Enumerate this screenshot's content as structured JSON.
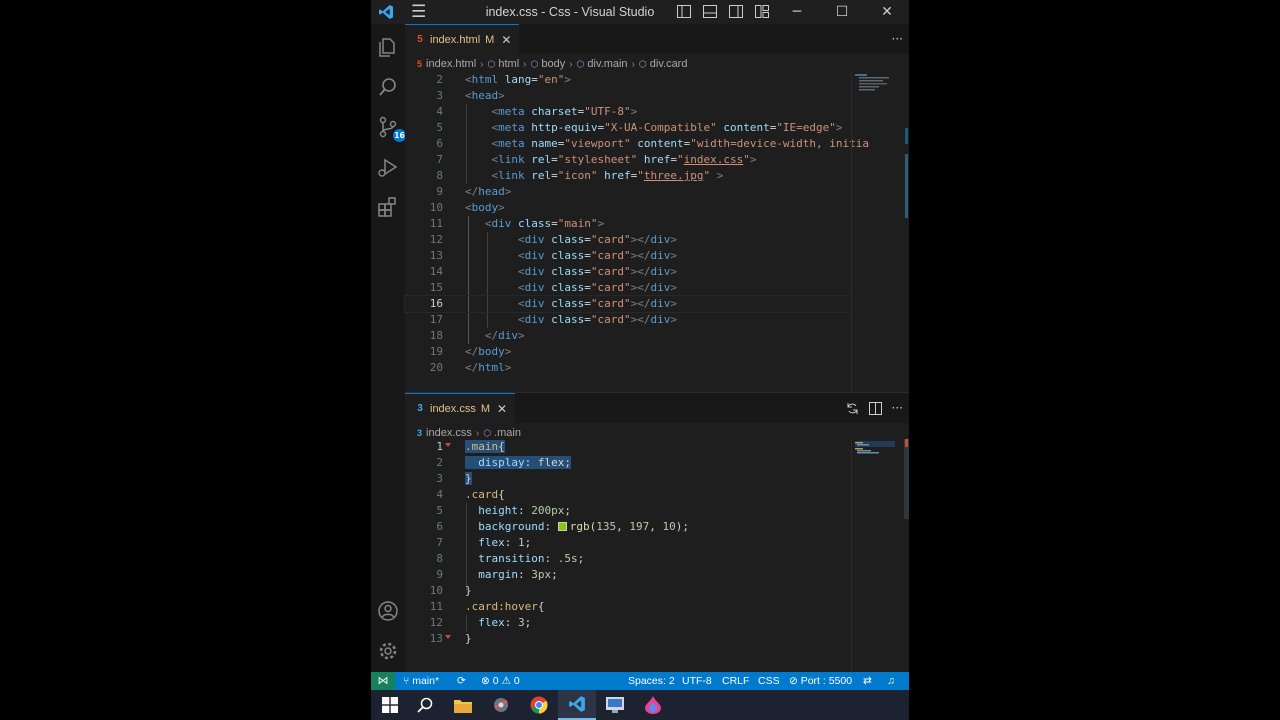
{
  "window": {
    "title": "index.css - Css - Visual Studio Code",
    "menu_icon": "hamburger-menu-icon",
    "controls": {
      "minimize": "─",
      "maximize": "☐",
      "close": "✕"
    }
  },
  "activity_bar": {
    "items": [
      {
        "name": "explorer-icon"
      },
      {
        "name": "search-icon"
      },
      {
        "name": "source-control-icon",
        "badge": "16"
      },
      {
        "name": "run-debug-icon"
      },
      {
        "name": "extensions-icon"
      }
    ],
    "bottom": [
      {
        "name": "accounts-icon"
      },
      {
        "name": "manage-gear-icon"
      }
    ]
  },
  "editor_top": {
    "tab": {
      "label": "index.html",
      "status": "M",
      "close": "✕",
      "icon": "5"
    },
    "actions": {
      "more": "···"
    },
    "breadcrumb": [
      "index.html",
      "html",
      "body",
      "div.main",
      "div.card"
    ],
    "lines": [
      {
        "n": "2",
        "text": "<html lang=\"en\">"
      },
      {
        "n": "3",
        "text": "<head>"
      },
      {
        "n": "4",
        "text": "    <meta charset=\"UTF-8\">"
      },
      {
        "n": "5",
        "text": "    <meta http-equiv=\"X-UA-Compatible\" content=\"IE=edge\">"
      },
      {
        "n": "6",
        "text": "    <meta name=\"viewport\" content=\"width=device-width, initia"
      },
      {
        "n": "7",
        "text": "    <link rel=\"stylesheet\" href=\"index.css\">"
      },
      {
        "n": "8",
        "text": "    <link rel=\"icon\" href=\"three.jpg\" >"
      },
      {
        "n": "9",
        "text": "</head>"
      },
      {
        "n": "10",
        "text": "<body>"
      },
      {
        "n": "11",
        "text": "   <div class=\"main\">"
      },
      {
        "n": "12",
        "text": "        <div class=\"card\"></div>"
      },
      {
        "n": "13",
        "text": "        <div class=\"card\"></div>"
      },
      {
        "n": "14",
        "text": "        <div class=\"card\"></div>"
      },
      {
        "n": "15",
        "text": "        <div class=\"card\"></div>"
      },
      {
        "n": "16",
        "text": "        <div class=\"card\"></div>"
      },
      {
        "n": "17",
        "text": "        <div class=\"card\"></div>"
      },
      {
        "n": "18",
        "text": "   </div>"
      },
      {
        "n": "19",
        "text": "</body>"
      },
      {
        "n": "20",
        "text": "</html>"
      }
    ]
  },
  "editor_bottom": {
    "tab": {
      "label": "index.css",
      "status": "M",
      "close": "✕",
      "icon": "3"
    },
    "actions": {
      "more": "···"
    },
    "breadcrumb": [
      "index.css",
      ".main"
    ],
    "lines": [
      {
        "n": "1",
        "text": ".main{"
      },
      {
        "n": "2",
        "text": "  display: flex;"
      },
      {
        "n": "3",
        "text": "}"
      },
      {
        "n": "4",
        "text": ".card{"
      },
      {
        "n": "5",
        "text": "  height: 200px;"
      },
      {
        "n": "6",
        "text": "  background: rgb(135, 197, 10);"
      },
      {
        "n": "7",
        "text": "  flex: 1;"
      },
      {
        "n": "8",
        "text": "  transition: .5s;"
      },
      {
        "n": "9",
        "text": "  margin: 3px;"
      },
      {
        "n": "10",
        "text": "}"
      },
      {
        "n": "11",
        "text": ".card:hover{"
      },
      {
        "n": "12",
        "text": "  flex: 3;"
      },
      {
        "n": "13",
        "text": "}"
      }
    ],
    "swatch_color": "#87c50a"
  },
  "status_bar": {
    "branch": "main*",
    "sync_icon": "⟳",
    "errors": "0",
    "warnings": "0",
    "spaces": "Spaces: 2",
    "encoding": "UTF-8",
    "eol": "CRLF",
    "language": "CSS",
    "port": "Port : 5500"
  },
  "taskbar": {
    "items": [
      "windows-start",
      "search",
      "file-explorer",
      "app-2",
      "chrome",
      "vscode",
      "app-6",
      "app-7"
    ],
    "active": "vscode"
  },
  "colors": {
    "accent": "#007acc",
    "editor_bg": "#1e1e1e",
    "selection": "#264f78"
  }
}
